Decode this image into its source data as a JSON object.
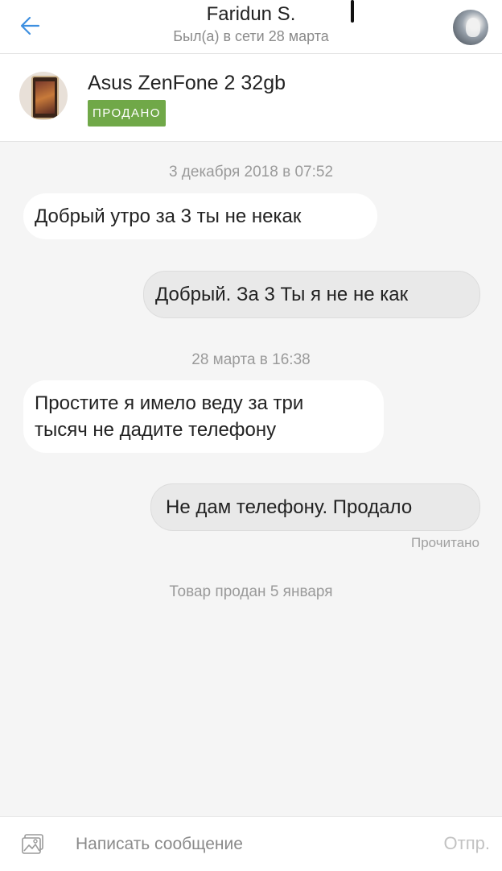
{
  "header": {
    "title": "Faridun S.",
    "status": "Был(а) в сети 28 марта",
    "back_icon": "arrow-left-icon",
    "accent_color": "#3d8fe0"
  },
  "product": {
    "title": "Asus ZenFone 2 32gb",
    "badge": "ПРОДАНО",
    "badge_color": "#70a848"
  },
  "chat": {
    "date1": "3 декабря 2018 в 07:52",
    "msg1": "Добрый утро за 3 ты не некак",
    "msg2": "Добрый. За 3 Ты я не не как",
    "date2": "28 марта в 16:38",
    "msg3_line1": "Простите я имело веду за три",
    "msg3_line2": "тысяч не дадите телефону",
    "msg4": "Не дам телефону. Продало",
    "read_receipt": "Прочитано",
    "system_notice": "Товар продан 5 января"
  },
  "composer": {
    "placeholder": "Написать сообщение",
    "send_label": "Отпр.",
    "attach_icon": "image-icon"
  }
}
